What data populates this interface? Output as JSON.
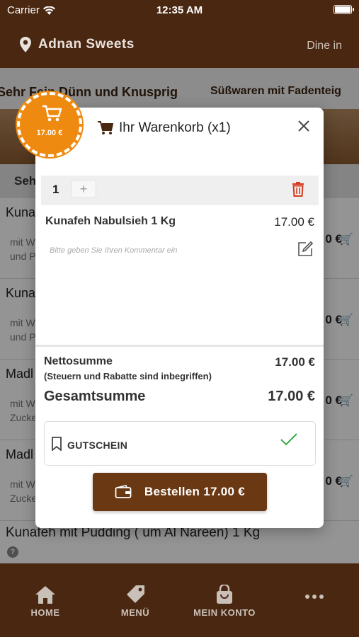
{
  "status": {
    "carrier": "Carrier",
    "time": "12:35 AM"
  },
  "header": {
    "title": "Adnan Sweets",
    "mode": "Dine in"
  },
  "background": {
    "tab1": "Sehr Fein Dünn und Knusprig",
    "tab2": "Süßwaren mit Fadenteig",
    "section": "Sehr",
    "rows": [
      {
        "name": "Kuna",
        "desc": "mit W\nund P",
        "price": "0 €"
      },
      {
        "name": "Kuna",
        "desc": "mit W\nund P",
        "price": "0 €"
      },
      {
        "name": "Madl",
        "desc": "mit W\nZucke",
        "price": "0 €"
      },
      {
        "name": "Madl",
        "desc": "mit W\nZucke",
        "price": "0 €"
      }
    ],
    "last_row": "Kunafeh mit Pudding ( um Al Nareen) 1 Kg"
  },
  "badge": {
    "price": "17.00 €"
  },
  "cart_modal": {
    "title": "Ihr Warenkorb (x1)",
    "quantity": "1",
    "plus": "+",
    "item_name": "Kunafeh Nabulsieh 1 Kg",
    "item_price": "17.00 €",
    "comment_placeholder": "Bitte geben Sie Ihren Kommentar ein",
    "net_label": "Nettosumme",
    "net_note": "(Steuern und Rabatte sind inbegriffen)",
    "net_value": "17.00 €",
    "total_label": "Gesamtsumme",
    "total_value": "17.00 €",
    "coupon_label": "GUTSCHEIN",
    "order_button": "Bestellen 17.00 €"
  },
  "tabs": [
    {
      "label": "HOME",
      "icon": "home-icon"
    },
    {
      "label": "MENÜ",
      "icon": "tag-icon"
    },
    {
      "label": "MEIN KONTO",
      "icon": "bag-icon"
    },
    {
      "label": "",
      "icon": "more-icon"
    }
  ],
  "colors": {
    "brand": "#4a2710",
    "accent": "#ef8a10",
    "button": "#6a3812",
    "delete": "#d83a1f",
    "check": "#3aa84a"
  }
}
